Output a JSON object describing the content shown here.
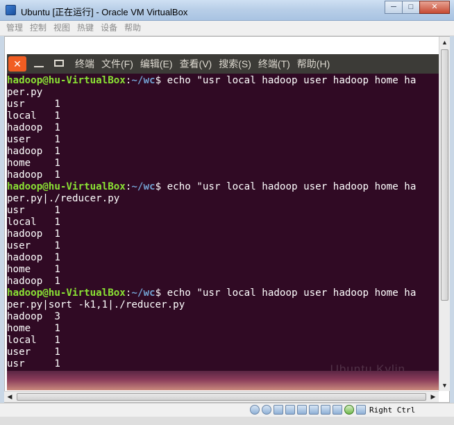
{
  "window": {
    "title": "Ubuntu [正在运行] - Oracle VM VirtualBox",
    "buttons": {
      "minimize": "─",
      "maximize": "□",
      "close": "✕"
    }
  },
  "menubar": {
    "items": [
      "管理",
      "控制",
      "视图",
      "热键",
      "设备",
      "帮助"
    ]
  },
  "terminal": {
    "window_buttons": {
      "close": "✕"
    },
    "menu": [
      "终端",
      "文件(F)",
      "编辑(E)",
      "查看(V)",
      "搜索(S)",
      "终端(T)",
      "帮助(H)"
    ],
    "prompt_user": "hadoop@hu-VirtualBox",
    "prompt_path": "~/wc",
    "lines": [
      {
        "type": "prompt",
        "cmd": " echo \"usr local hadoop user hadoop home ha"
      },
      {
        "type": "out",
        "text": "per.py"
      },
      {
        "type": "out",
        "text": "usr     1"
      },
      {
        "type": "out",
        "text": "local   1"
      },
      {
        "type": "out",
        "text": "hadoop  1"
      },
      {
        "type": "out",
        "text": "user    1"
      },
      {
        "type": "out",
        "text": "hadoop  1"
      },
      {
        "type": "out",
        "text": "home    1"
      },
      {
        "type": "out",
        "text": "hadoop  1"
      },
      {
        "type": "prompt",
        "cmd": " echo \"usr local hadoop user hadoop home ha"
      },
      {
        "type": "out",
        "text": "per.py|./reducer.py"
      },
      {
        "type": "out",
        "text": "usr     1"
      },
      {
        "type": "out",
        "text": "local   1"
      },
      {
        "type": "out",
        "text": "hadoop  1"
      },
      {
        "type": "out",
        "text": "user    1"
      },
      {
        "type": "out",
        "text": "hadoop  1"
      },
      {
        "type": "out",
        "text": "home    1"
      },
      {
        "type": "out",
        "text": "hadoop  1"
      },
      {
        "type": "prompt",
        "cmd": " echo \"usr local hadoop user hadoop home ha"
      },
      {
        "type": "out",
        "text": "per.py|sort -k1,1|./reducer.py"
      },
      {
        "type": "out",
        "text": "hadoop  3"
      },
      {
        "type": "out",
        "text": "home    1"
      },
      {
        "type": "out",
        "text": "local   1"
      },
      {
        "type": "out",
        "text": "user    1"
      },
      {
        "type": "out",
        "text": "usr     1"
      }
    ],
    "watermark": "Ubuntu Kylin"
  },
  "statusbar": {
    "icons": [
      "hard-disk-icon",
      "optical-drive-icon",
      "usb-icon",
      "shared-folders-icon",
      "network-icon",
      "display-icon",
      "capture-icon",
      "video-capture-icon",
      "mouse-integration-icon",
      "keyboard-capture-icon"
    ],
    "host_key": "Right Ctrl"
  }
}
